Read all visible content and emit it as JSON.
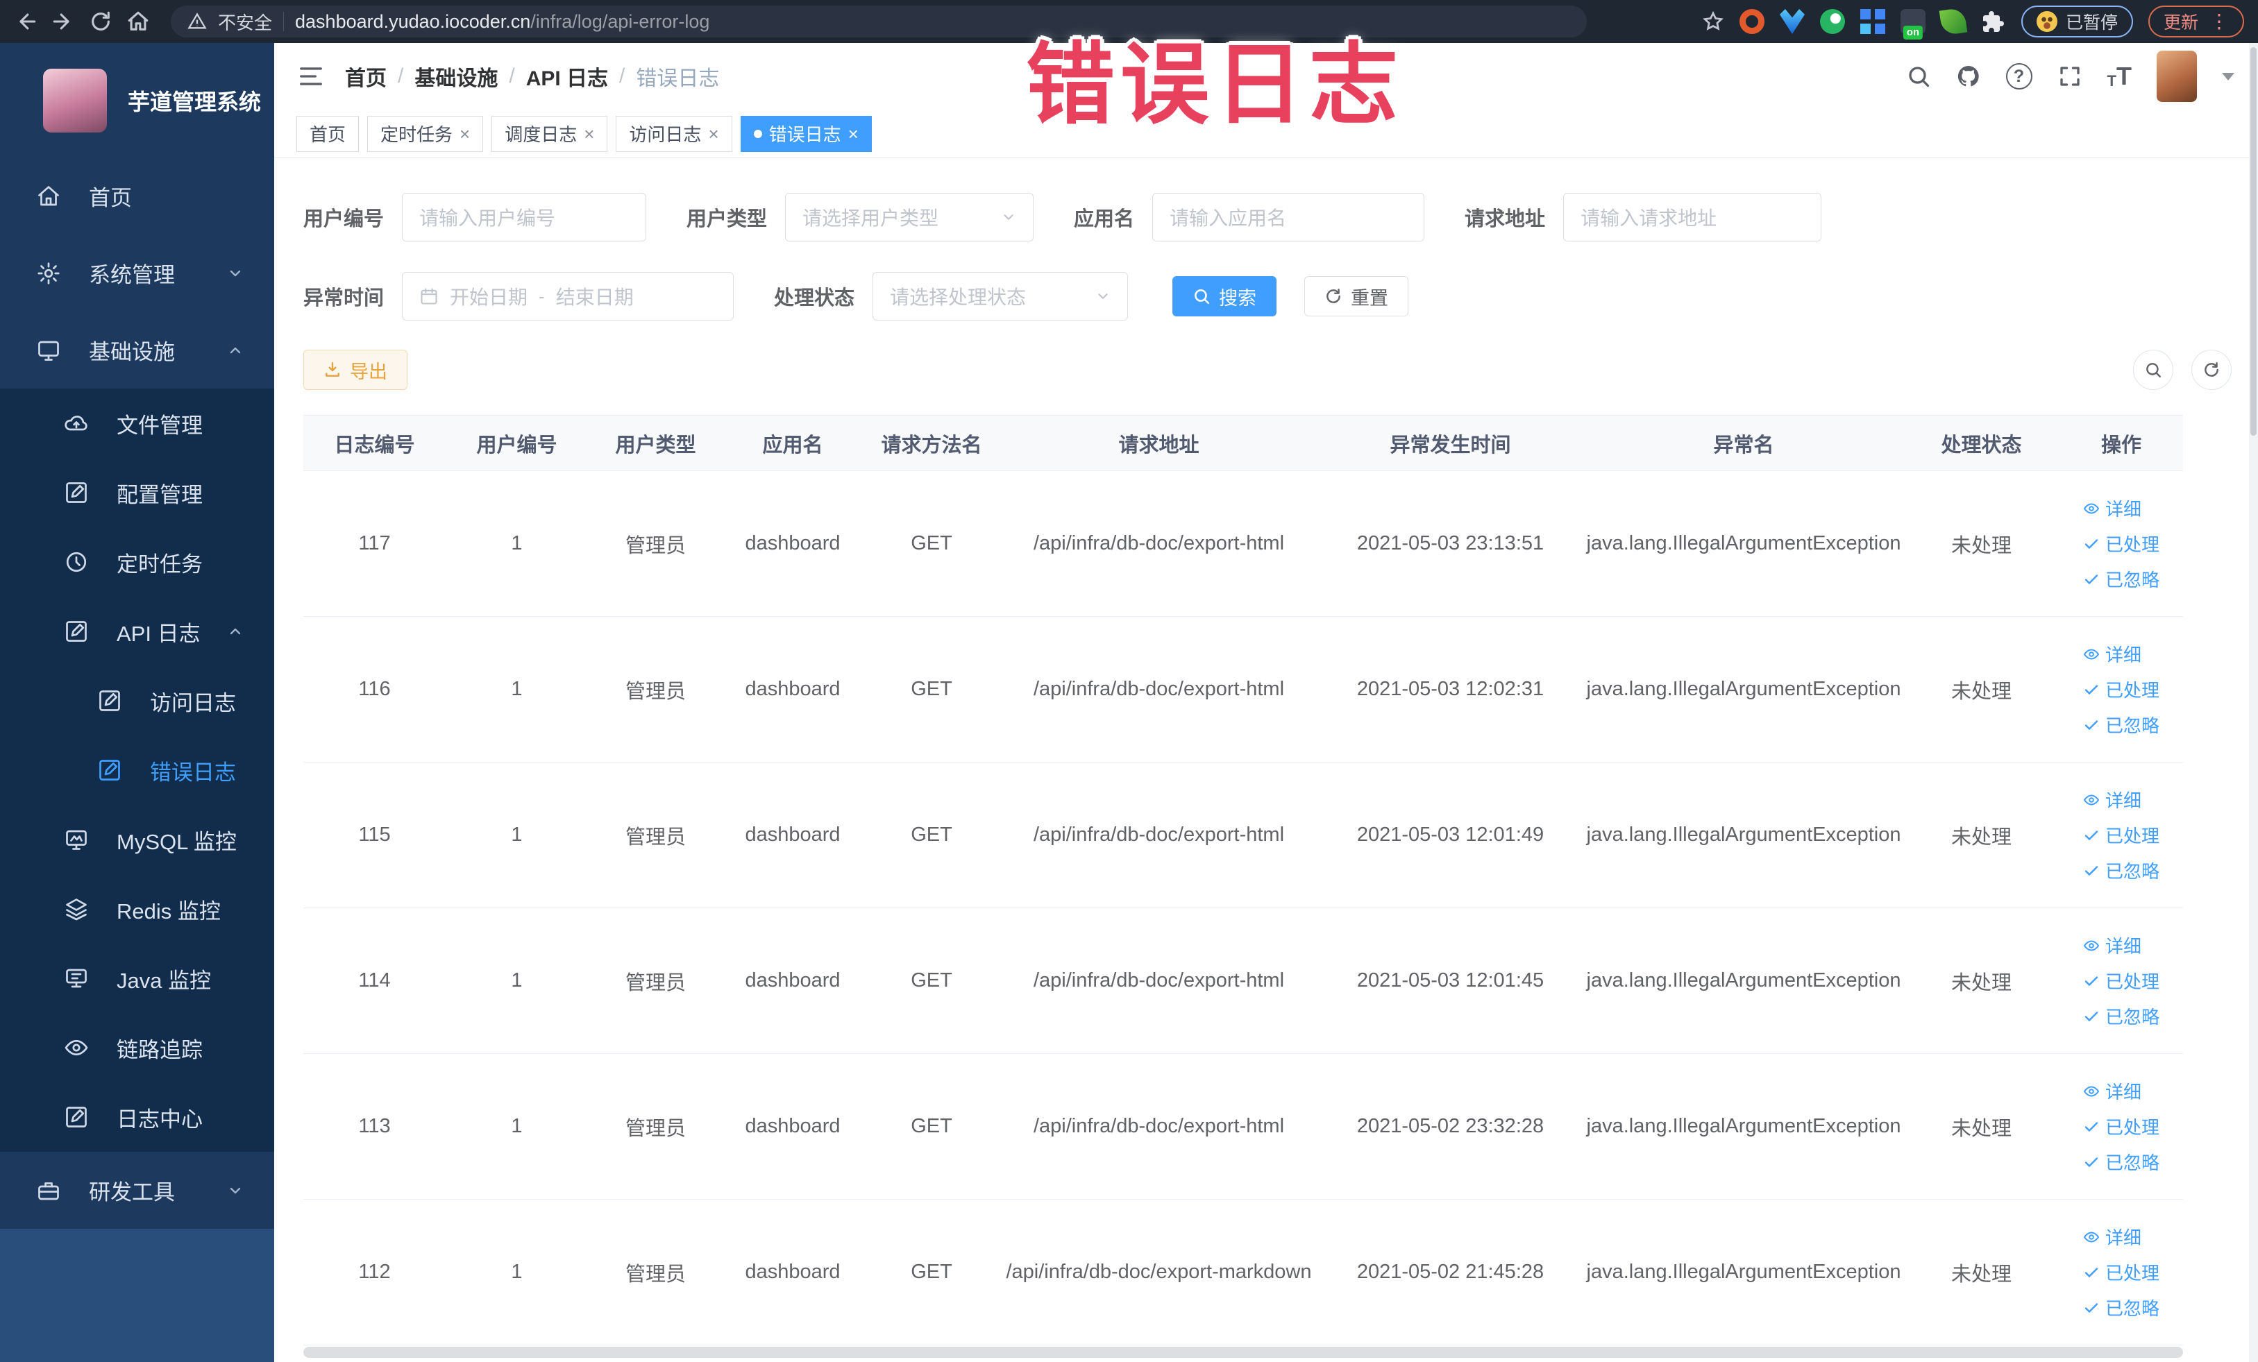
{
  "annotation": {
    "text": "错误日志",
    "color": "#e8415e"
  },
  "browser": {
    "security_label": "不安全",
    "url_host": "dashboard.yudao.iocoder.cn",
    "url_path": "/infra/log/api-error-log",
    "paused_label": "已暂停",
    "update_label": "更新"
  },
  "sidebar": {
    "title": "芋道管理系统",
    "items": [
      {
        "label": "首页"
      },
      {
        "label": "系统管理"
      },
      {
        "label": "基础设施"
      },
      {
        "label": "文件管理"
      },
      {
        "label": "配置管理"
      },
      {
        "label": "定时任务"
      },
      {
        "label": "API 日志"
      },
      {
        "label": "访问日志"
      },
      {
        "label": "错误日志"
      },
      {
        "label": "MySQL 监控"
      },
      {
        "label": "Redis 监控"
      },
      {
        "label": "Java 监控"
      },
      {
        "label": "链路追踪"
      },
      {
        "label": "日志中心"
      },
      {
        "label": "研发工具"
      }
    ]
  },
  "header": {
    "breadcrumb": {
      "items": [
        "首页",
        "基础设施",
        "API 日志",
        "错误日志"
      ],
      "separator": "/"
    }
  },
  "tabs": {
    "items": [
      {
        "label": "首页"
      },
      {
        "label": "定时任务"
      },
      {
        "label": "调度日志"
      },
      {
        "label": "访问日志"
      },
      {
        "label": "错误日志"
      }
    ]
  },
  "filters": {
    "user_id": {
      "label": "用户编号",
      "placeholder": "请输入用户编号"
    },
    "user_type": {
      "label": "用户类型",
      "placeholder": "请选择用户类型"
    },
    "app_name": {
      "label": "应用名",
      "placeholder": "请输入应用名"
    },
    "request_url": {
      "label": "请求地址",
      "placeholder": "请输入请求地址"
    },
    "exception_time": {
      "label": "异常时间",
      "start_placeholder": "开始日期",
      "separator": "-",
      "end_placeholder": "结束日期"
    },
    "process_status": {
      "label": "处理状态",
      "placeholder": "请选择处理状态"
    },
    "search_label": "搜索",
    "reset_label": "重置",
    "export_label": "导出"
  },
  "table": {
    "columns": [
      "日志编号",
      "用户编号",
      "用户类型",
      "应用名",
      "请求方法名",
      "请求地址",
      "异常发生时间",
      "异常名",
      "处理状态",
      "操作"
    ],
    "actions": {
      "detail": "详细",
      "processed": "已处理",
      "ignored": "已忽略"
    },
    "rows": [
      {
        "id": "117",
        "user_id": "1",
        "user_type": "管理员",
        "app": "dashboard",
        "method": "GET",
        "url": "/api/infra/db-doc/export-html",
        "time": "2021-05-03 23:13:51",
        "exception": "java.lang.IllegalArgumentException",
        "status": "未处理"
      },
      {
        "id": "116",
        "user_id": "1",
        "user_type": "管理员",
        "app": "dashboard",
        "method": "GET",
        "url": "/api/infra/db-doc/export-html",
        "time": "2021-05-03 12:02:31",
        "exception": "java.lang.IllegalArgumentException",
        "status": "未处理"
      },
      {
        "id": "115",
        "user_id": "1",
        "user_type": "管理员",
        "app": "dashboard",
        "method": "GET",
        "url": "/api/infra/db-doc/export-html",
        "time": "2021-05-03 12:01:49",
        "exception": "java.lang.IllegalArgumentException",
        "status": "未处理"
      },
      {
        "id": "114",
        "user_id": "1",
        "user_type": "管理员",
        "app": "dashboard",
        "method": "GET",
        "url": "/api/infra/db-doc/export-html",
        "time": "2021-05-03 12:01:45",
        "exception": "java.lang.IllegalArgumentException",
        "status": "未处理"
      },
      {
        "id": "113",
        "user_id": "1",
        "user_type": "管理员",
        "app": "dashboard",
        "method": "GET",
        "url": "/api/infra/db-doc/export-html",
        "time": "2021-05-02 23:32:28",
        "exception": "java.lang.IllegalArgumentException",
        "status": "未处理"
      },
      {
        "id": "112",
        "user_id": "1",
        "user_type": "管理员",
        "app": "dashboard",
        "method": "GET",
        "url": "/api/infra/db-doc/export-markdown",
        "time": "2021-05-02 21:45:28",
        "exception": "java.lang.IllegalArgumentException",
        "status": "未处理"
      }
    ]
  }
}
